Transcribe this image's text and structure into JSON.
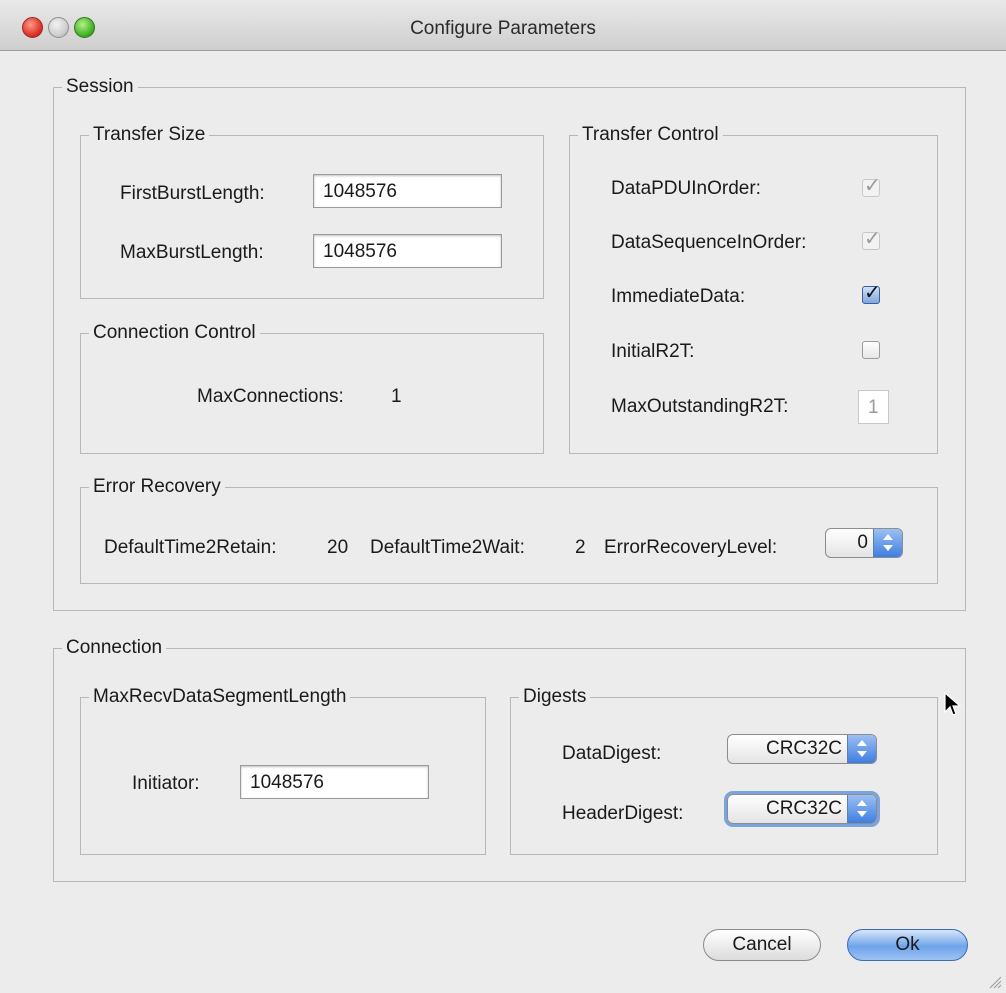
{
  "window": {
    "title": "Configure Parameters"
  },
  "session": {
    "legend": "Session",
    "transfer_size": {
      "legend": "Transfer Size",
      "first_burst_label": "FirstBurstLength:",
      "first_burst_value": "1048576",
      "max_burst_label": "MaxBurstLength:",
      "max_burst_value": "1048576"
    },
    "connection_control": {
      "legend": "Connection Control",
      "max_connections_label": "MaxConnections:",
      "max_connections_value": "1"
    },
    "transfer_control": {
      "legend": "Transfer Control",
      "items": [
        {
          "label": "DataPDUInOrder:",
          "checked": true,
          "enabled": false
        },
        {
          "label": "DataSequenceInOrder:",
          "checked": true,
          "enabled": false
        },
        {
          "label": "ImmediateData:",
          "checked": true,
          "enabled": true
        },
        {
          "label": "InitialR2T:",
          "checked": false,
          "enabled": true
        }
      ],
      "max_outstanding_label": "MaxOutstandingR2T:",
      "max_outstanding_value": "1"
    },
    "error_recovery": {
      "legend": "Error Recovery",
      "time2retain_label": "DefaultTime2Retain:",
      "time2retain_value": "20",
      "time2wait_label": "DefaultTime2Wait:",
      "time2wait_value": "2",
      "level_label": "ErrorRecoveryLevel:",
      "level_value": "0"
    }
  },
  "connection": {
    "legend": "Connection",
    "max_recv": {
      "legend": "MaxRecvDataSegmentLength",
      "initiator_label": "Initiator:",
      "initiator_value": "1048576"
    },
    "digests": {
      "legend": "Digests",
      "data_digest_label": "DataDigest:",
      "data_digest_value": "CRC32C",
      "header_digest_label": "HeaderDigest:",
      "header_digest_value": "CRC32C"
    }
  },
  "buttons": {
    "cancel": "Cancel",
    "ok": "Ok"
  },
  "icons": {
    "close": "close-icon",
    "minimize": "minimize-icon",
    "zoom": "zoom-icon",
    "checkmark": "checkmark-icon",
    "cursor": "mouse-pointer-icon",
    "resize": "resize-grip-icon"
  },
  "colors": {
    "accent": "#3f7de0",
    "close": "#e0382b",
    "zoom": "#49b52a"
  }
}
